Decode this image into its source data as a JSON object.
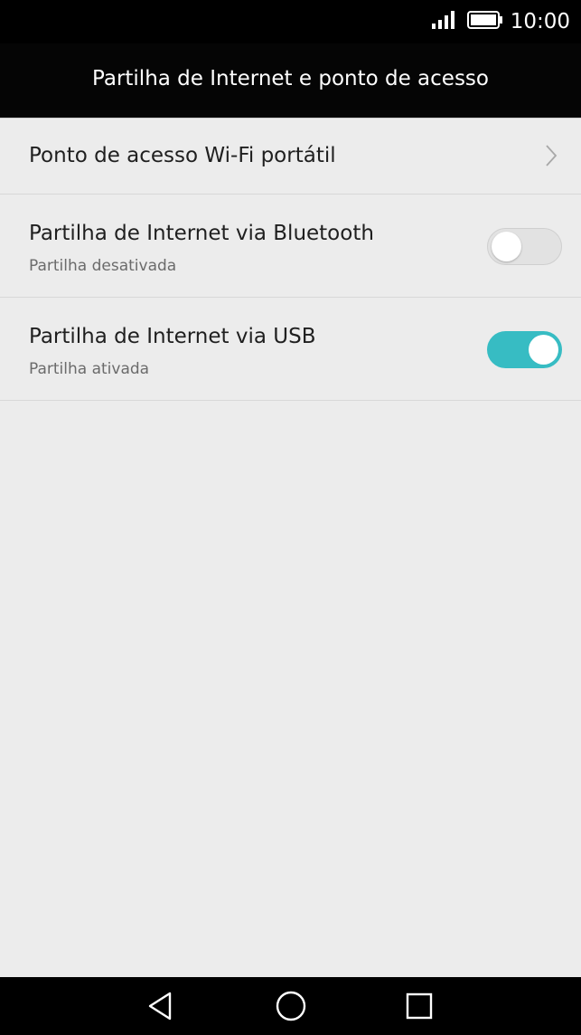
{
  "status_bar": {
    "time": "10:00",
    "icons": [
      "signal-icon",
      "battery-icon"
    ]
  },
  "header": {
    "title": "Partilha de Internet e ponto de acesso"
  },
  "settings": [
    {
      "title": "Ponto de acesso Wi-Fi portátil",
      "type": "navigation",
      "icon": "chevron-right-icon"
    },
    {
      "title": "Partilha de Internet via Bluetooth",
      "subtitle": "Partilha desativada",
      "type": "toggle",
      "enabled": false
    },
    {
      "title": "Partilha de Internet via USB",
      "subtitle": "Partilha ativada",
      "type": "toggle",
      "enabled": true
    }
  ],
  "navigation_bar": {
    "buttons": [
      "back-icon",
      "home-icon",
      "recent-apps-icon"
    ]
  },
  "colors": {
    "background": "#ececec",
    "status_bar": "#000000",
    "toggle_on": "#37bcc3",
    "toggle_off": "#e2e2e2",
    "text_primary": "#1f1f1f",
    "text_secondary": "#6b6b6b"
  }
}
